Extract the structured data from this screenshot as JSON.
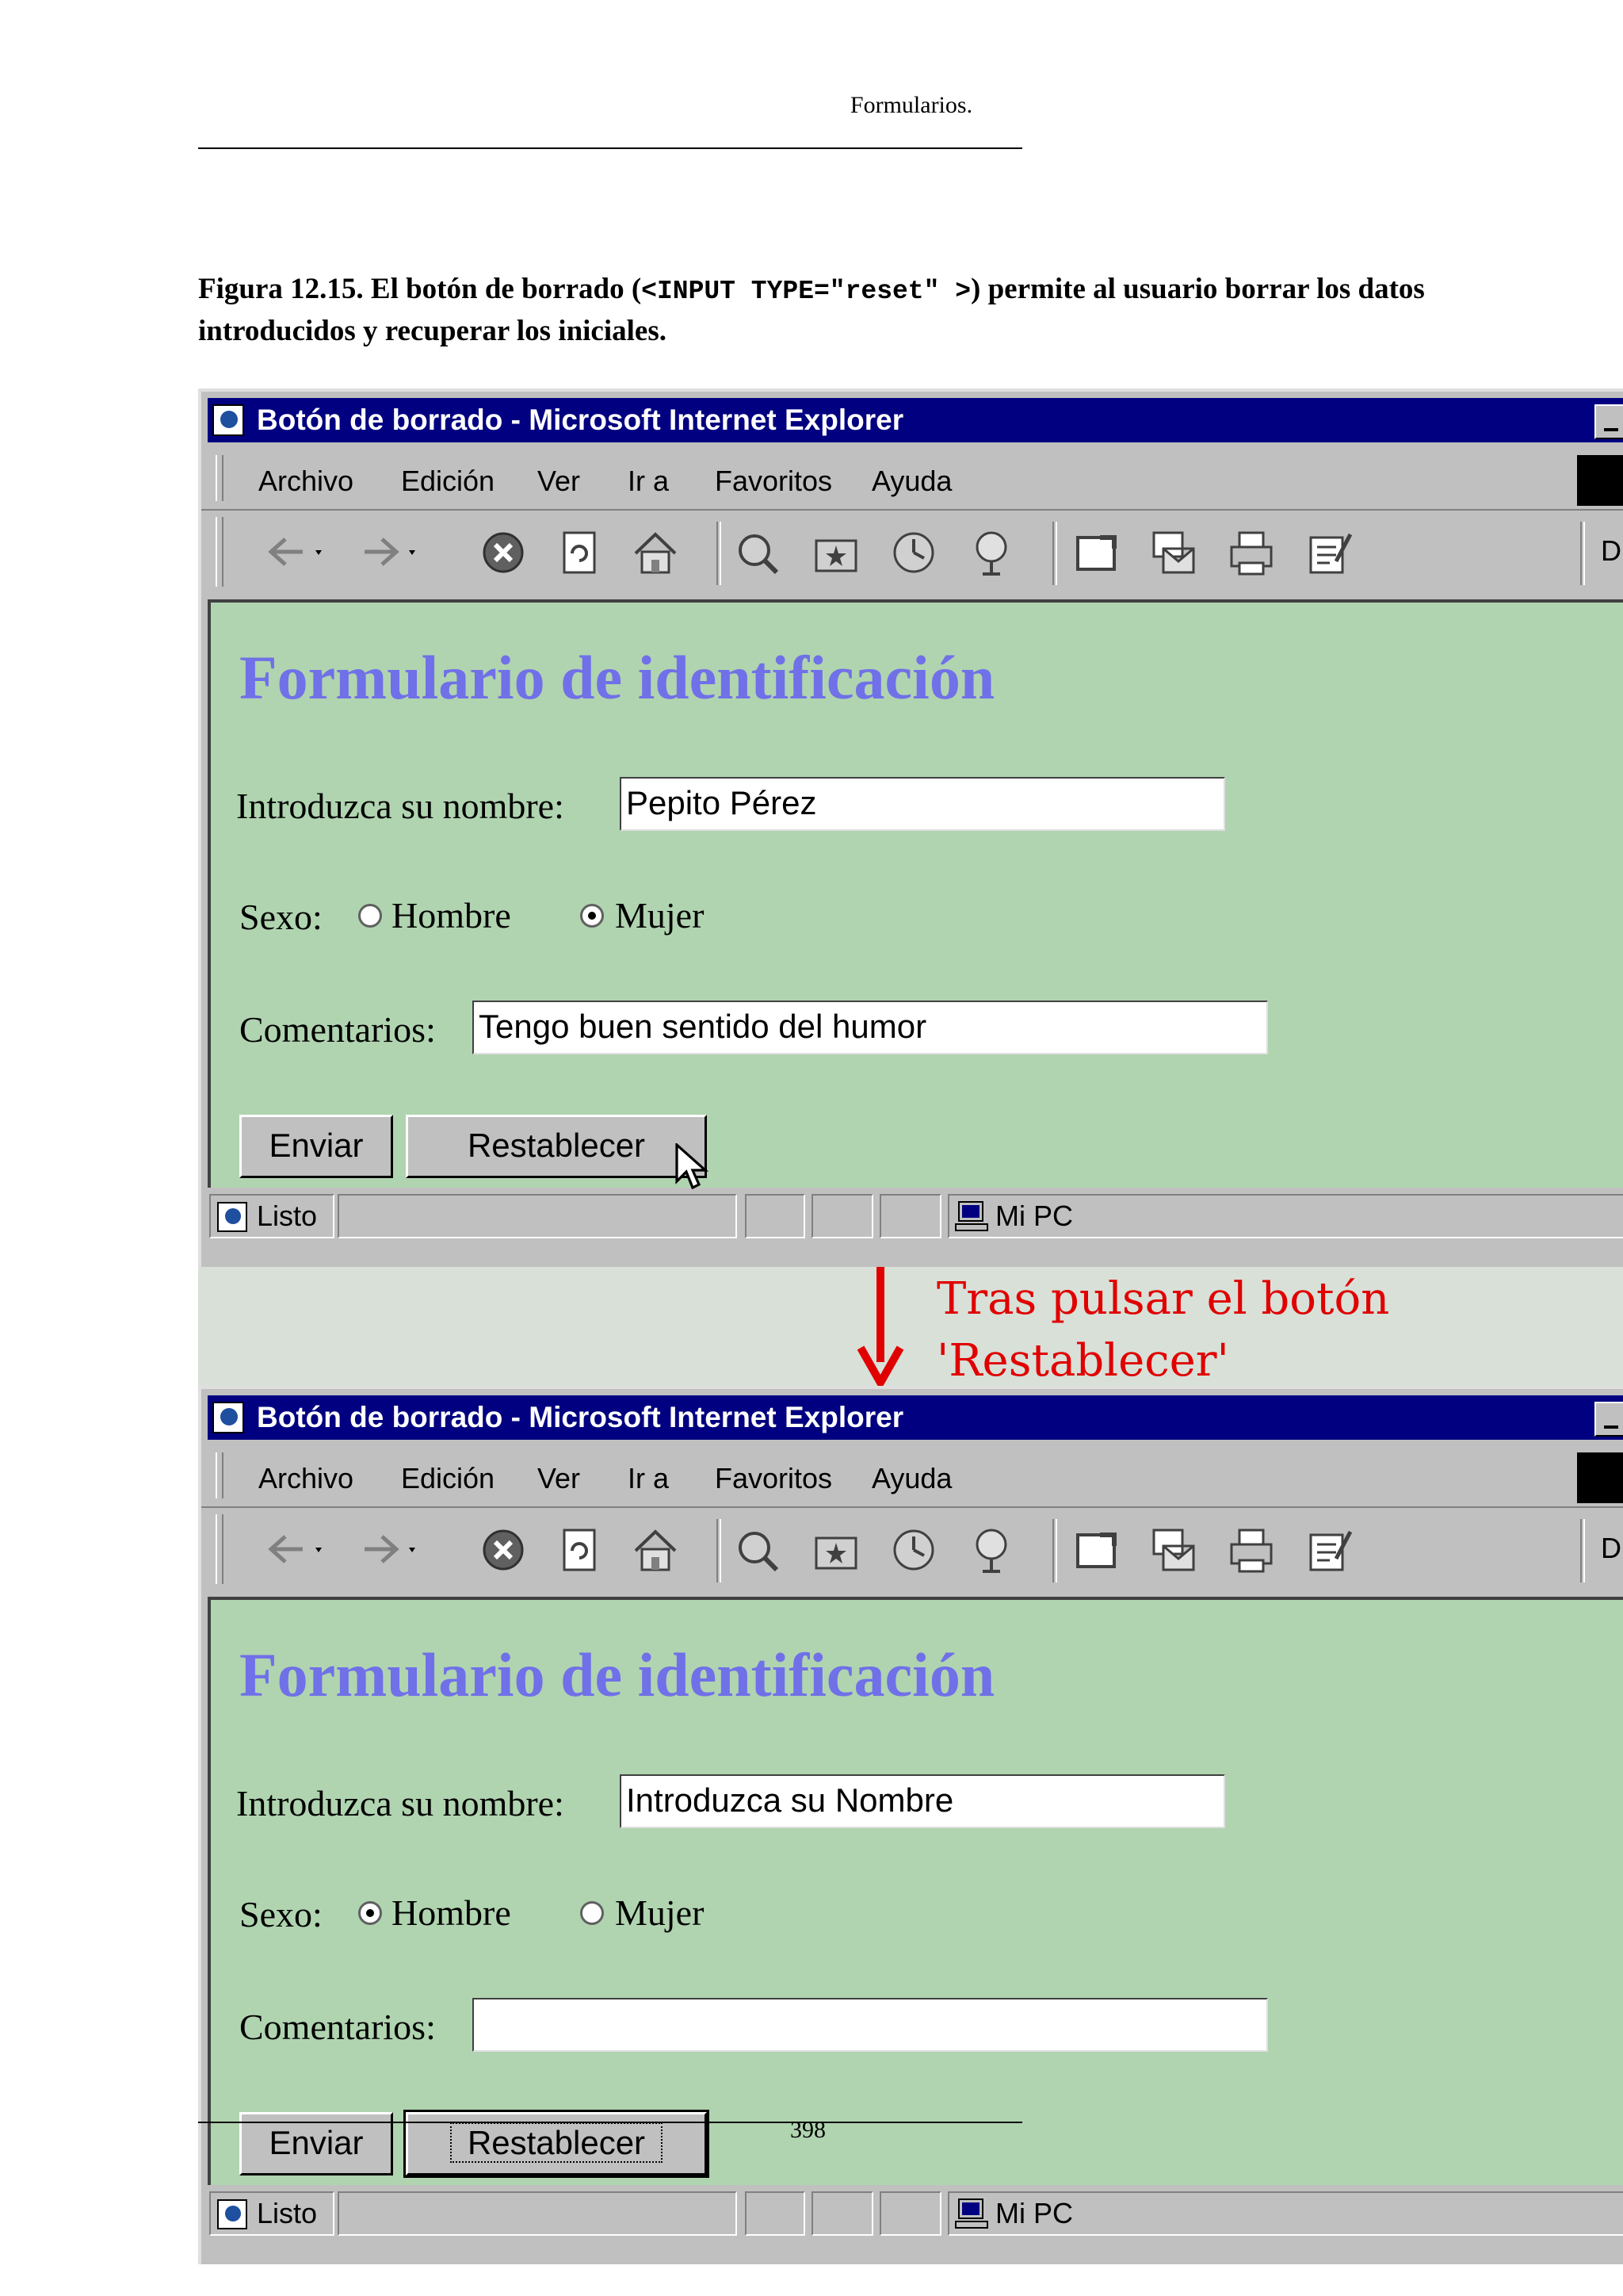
{
  "page": {
    "header": "Formularios.",
    "page_number": "398"
  },
  "caption": {
    "figure": "Figura 12.15.",
    "text_before_code": "El botón de borrado (",
    "code": "<INPUT TYPE=\"reset\" >",
    "text_after_code": ") permite al usuario borrar los datos introducidos y recuperar los iniciales."
  },
  "browser": {
    "title": "Botón de borrado - Microsoft Internet Explorer",
    "menu": [
      "Archivo",
      "Edición",
      "Ver",
      "Ir a",
      "Favoritos",
      "Ayuda"
    ],
    "toolbar_right_label": "Di",
    "status_text": "Listo",
    "status_zone": "Mi PC"
  },
  "form": {
    "title": "Formulario de identificación",
    "name_label": "Introduzca su nombre:",
    "sex_label": "Sexo:",
    "option_male": "Hombre",
    "option_female": "Mujer",
    "comments_label": "Comentarios:",
    "submit_label": "Enviar",
    "reset_label": "Restablecer"
  },
  "before": {
    "name_value": "Pepito Pérez",
    "sex_selected": "Mujer",
    "comments_value": "Tengo buen sentido del humor"
  },
  "after": {
    "name_value": "Introduzca su Nombre",
    "sex_selected": "Hombre",
    "comments_value": ""
  },
  "annotation": {
    "line1": "Tras pulsar el botón",
    "line2": "'Restablecer'",
    "color": "#e00000"
  }
}
